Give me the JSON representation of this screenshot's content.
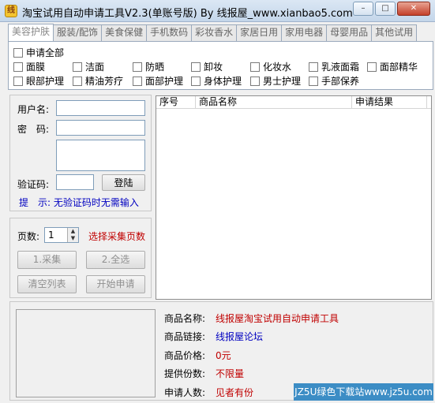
{
  "window": {
    "title": "淘宝试用自动申请工具V2.3(单账号版)  By 线报屋_www.xianbao5.com",
    "app_icon_glyph": "线",
    "min_glyph": "–",
    "max_glyph": "□",
    "close_glyph": "✕"
  },
  "tabs": [
    "美容护肤",
    "服装/配饰",
    "美食保健",
    "手机数码",
    "彩妆香水",
    "家居日用",
    "家用电器",
    "母婴用品",
    "其他试用"
  ],
  "categories": {
    "select_all": "申请全部",
    "row1": [
      "面膜",
      "洁面",
      "防晒",
      "卸妆",
      "化妆水",
      "乳液面霜",
      "面部精华"
    ],
    "row2": [
      "眼部护理",
      "精油芳疗",
      "面部护理",
      "身体护理",
      "男士护理",
      "手部保养"
    ]
  },
  "login": {
    "username_label": "用户名:",
    "password_label": "密　码:",
    "captcha_label": "验证码:",
    "login_button": "登陆",
    "hint": "提　示: 无验证码时无需输入"
  },
  "collect": {
    "pages_label": "页数:",
    "pages_value": "1",
    "pages_hint": "选择采集页数",
    "collect_button": "1.采集",
    "select_all_button": "2.全选",
    "clear_button": "清空列表",
    "start_button": "开始申请"
  },
  "list": {
    "columns": [
      "序号",
      "商品名称",
      "申请结果"
    ]
  },
  "product": {
    "name_label": "商品名称:",
    "name_value": "线报屋淘宝试用自动申请工具",
    "link_label": "商品链接:",
    "link_value": "线报屋论坛",
    "price_label": "商品价格:",
    "price_value": "0元",
    "qty_label": "提供份数:",
    "qty_value": "不限量",
    "applicants_label": "申请人数:",
    "applicants_value": "见者有份"
  },
  "watermark": "JZ5U绿色下载站www.jz5u.com",
  "colors": {
    "accent_red": "#c00000",
    "hint_blue": "#0000c0",
    "link_blue": "#0000c0",
    "watermark_bg": "#3c8dc5"
  }
}
